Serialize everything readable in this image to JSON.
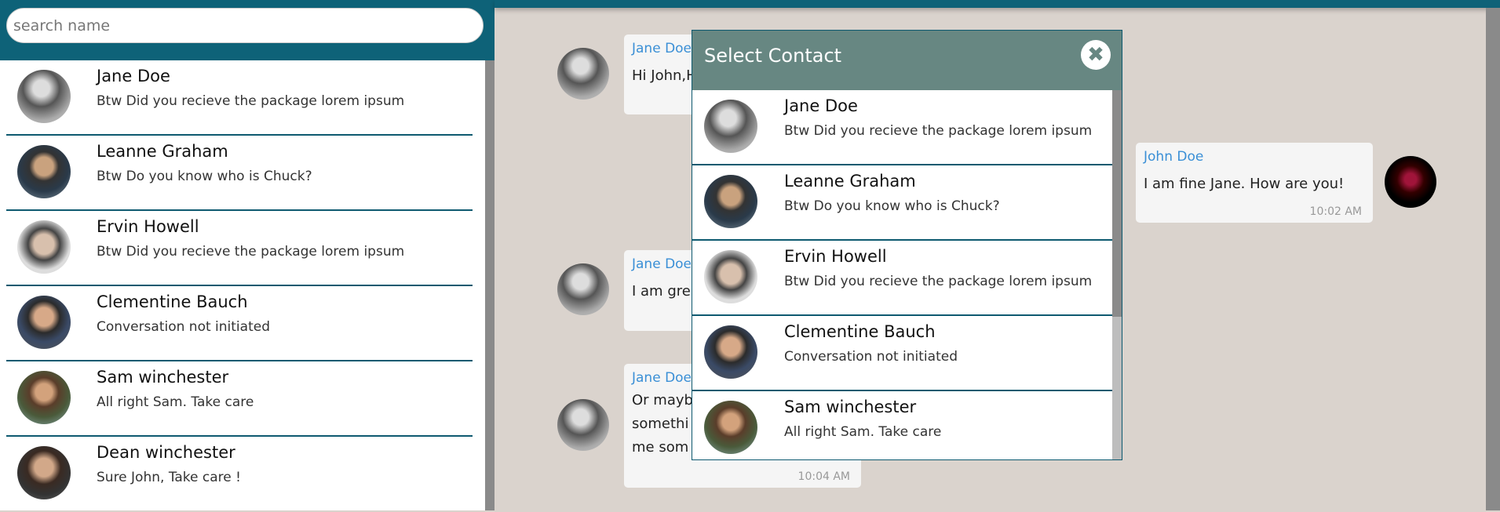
{
  "sidebar": {
    "search_placeholder": "search name",
    "contacts": [
      {
        "name": "Jane Doe",
        "last_message": "Btw Did you recieve the package lorem ipsum"
      },
      {
        "name": "Leanne Graham",
        "last_message": "Btw Do you know who is Chuck?"
      },
      {
        "name": "Ervin Howell",
        "last_message": "Btw Did you recieve the package lorem ipsum"
      },
      {
        "name": "Clementine Bauch",
        "last_message": "Conversation not initiated"
      },
      {
        "name": "Sam winchester",
        "last_message": "All right Sam. Take care"
      },
      {
        "name": "Dean winchester",
        "last_message": "Sure John, Take care !"
      }
    ]
  },
  "chat": {
    "messages": [
      {
        "sender": "Jane Doe",
        "text": "Hi John,H"
      },
      {
        "sender": "John Doe",
        "text": "I am fine Jane. How are you!",
        "time": "10:02 AM"
      },
      {
        "sender": "Jane Doe",
        "text": "I am grea"
      },
      {
        "sender": "Jane Doe",
        "text": "Or mayb\nsomethi\nme som",
        "time": "10:04 AM"
      }
    ]
  },
  "modal": {
    "title": "Select Contact",
    "close_icon": "close-icon",
    "contacts": [
      {
        "name": "Jane Doe",
        "last_message": "Btw Did you recieve the package lorem ipsum"
      },
      {
        "name": "Leanne Graham",
        "last_message": "Btw Do you know who is Chuck?"
      },
      {
        "name": "Ervin Howell",
        "last_message": "Btw Did you recieve the package lorem ipsum"
      },
      {
        "name": "Clementine Bauch",
        "last_message": "Conversation not initiated"
      },
      {
        "name": "Sam winchester",
        "last_message": "All right Sam. Take care"
      }
    ]
  },
  "colors": {
    "header": "#0e6278",
    "modal_header": "#678782",
    "sender_name": "#3a8fd6",
    "background": "#dad3cd"
  }
}
